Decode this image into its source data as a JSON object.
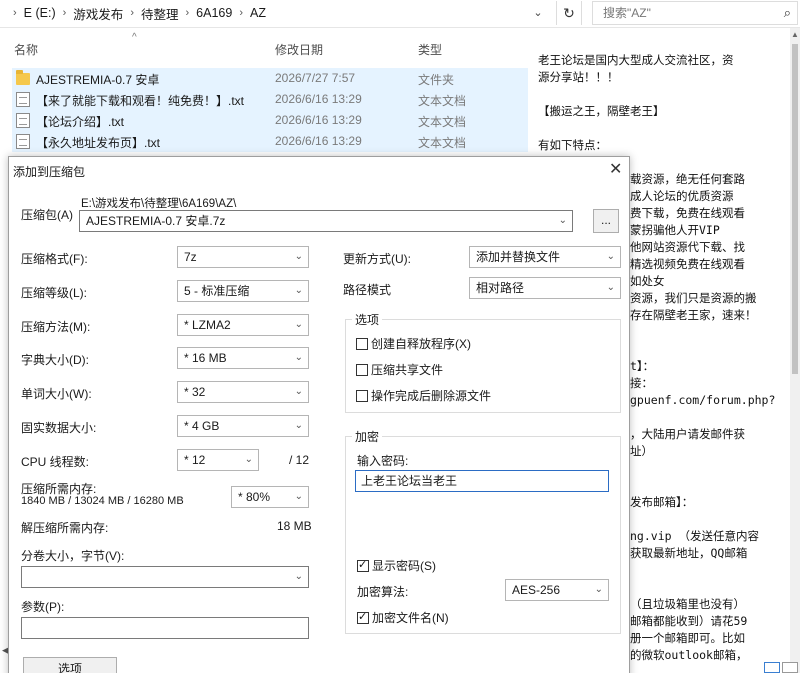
{
  "address_bar": {
    "crumbs": [
      "E (E:)",
      "游戏发布",
      "待整理",
      "6A169",
      "AZ"
    ],
    "search_placeholder": "搜索\"AZ\""
  },
  "file_list": {
    "columns": {
      "name": "名称",
      "date": "修改日期",
      "type": "类型"
    },
    "rows": [
      {
        "name": "AJESTREMIA-0.7 安卓",
        "date": "2026/7/27 7:57",
        "type": "文件夹",
        "icon": "folder-icon",
        "selected": true
      },
      {
        "name": "【来了就能下载和观看！纯免费！】.txt",
        "date": "2026/6/16 13:29",
        "type": "文本文档",
        "icon": "text-file-icon",
        "selected": false
      },
      {
        "name": "【论坛介绍】.txt",
        "date": "2026/6/16 13:29",
        "type": "文本文档",
        "icon": "text-file-icon",
        "selected": false
      },
      {
        "name": "【永久地址发布页】.txt",
        "date": "2026/6/16 13:29",
        "type": "文本文档",
        "icon": "text-file-icon",
        "selected": false
      }
    ]
  },
  "preview": {
    "lines": [
      "老王论坛是国内大型成人交流社区，资",
      "源分享站！！！",
      "【搬运之王，隔壁老王】",
      "有如下特点：",
      "载资源，绝无任何套路",
      "成人论坛的优质资源",
      "费下载，免费在线观看",
      "蒙拐骗他人开VIP",
      "他网站资源代下载、找",
      "精选视频免费在线观看",
      "如处女",
      "资源，我们只是资源的搬",
      "存在隔壁老王家，速来！",
      "t】：",
      "接：",
      "gpuenf.com/forum.php?",
      "，大陆用户请发邮件获",
      "址）",
      "发布邮箱】：",
      "ng.vip  （发送任意内容",
      "获取最新地址，QQ邮箱",
      "（且垃圾箱里也没有）",
      "邮箱都能收到）请花59",
      "册一个邮箱即可。比如",
      "的微软outlook邮箱，"
    ]
  },
  "dialog": {
    "title": "添加到压缩包",
    "archive_label": "压缩包(A)",
    "archive_path": "E:\\游戏发布\\待整理\\6A169\\AZ\\",
    "archive_name": "AJESTREMIA-0.7 安卓.7z",
    "browse_label": "...",
    "format_label": "压缩格式(F):",
    "format_value": "7z",
    "level_label": "压缩等级(L):",
    "level_value": "5 - 标准压缩",
    "method_label": "压缩方法(M):",
    "method_value": "* LZMA2",
    "dict_label": "字典大小(D):",
    "dict_value": "* 16 MB",
    "word_label": "单词大小(W):",
    "word_value": "* 32",
    "solid_label": "固实数据大小:",
    "solid_value": "* 4 GB",
    "threads_label": "CPU 线程数:",
    "threads_value": "* 12",
    "threads_total": "/ 12",
    "mem_comp_label": "压缩所需内存:",
    "mem_comp_value": "1840 MB / 13024 MB / 16280 MB",
    "mem_percent": "* 80%",
    "mem_decomp_label": "解压缩所需内存:",
    "mem_decomp_value": "18 MB",
    "split_label": "分卷大小，字节(V):",
    "split_value": "",
    "params_label": "参数(P):",
    "params_value": "",
    "options_button": "选项",
    "update_label": "更新方式(U):",
    "update_value": "添加并替换文件",
    "path_label": "路径模式",
    "path_value": "相对路径",
    "options_group": "选项",
    "opt_sfx": "创建自释放程序(X)",
    "opt_shared": "压缩共享文件",
    "opt_delete": "操作完成后删除源文件",
    "encrypt_group": "加密",
    "password_label": "输入密码:",
    "password_value": "上老王论坛当老王",
    "show_password": "显示密码(S)",
    "algo_label": "加密算法:",
    "algo_value": "AES-256",
    "encrypt_names": "加密文件名(N)",
    "checkboxes": {
      "sfx": false,
      "shared": false,
      "delete": false,
      "show_password": true,
      "encrypt_names": true
    }
  }
}
